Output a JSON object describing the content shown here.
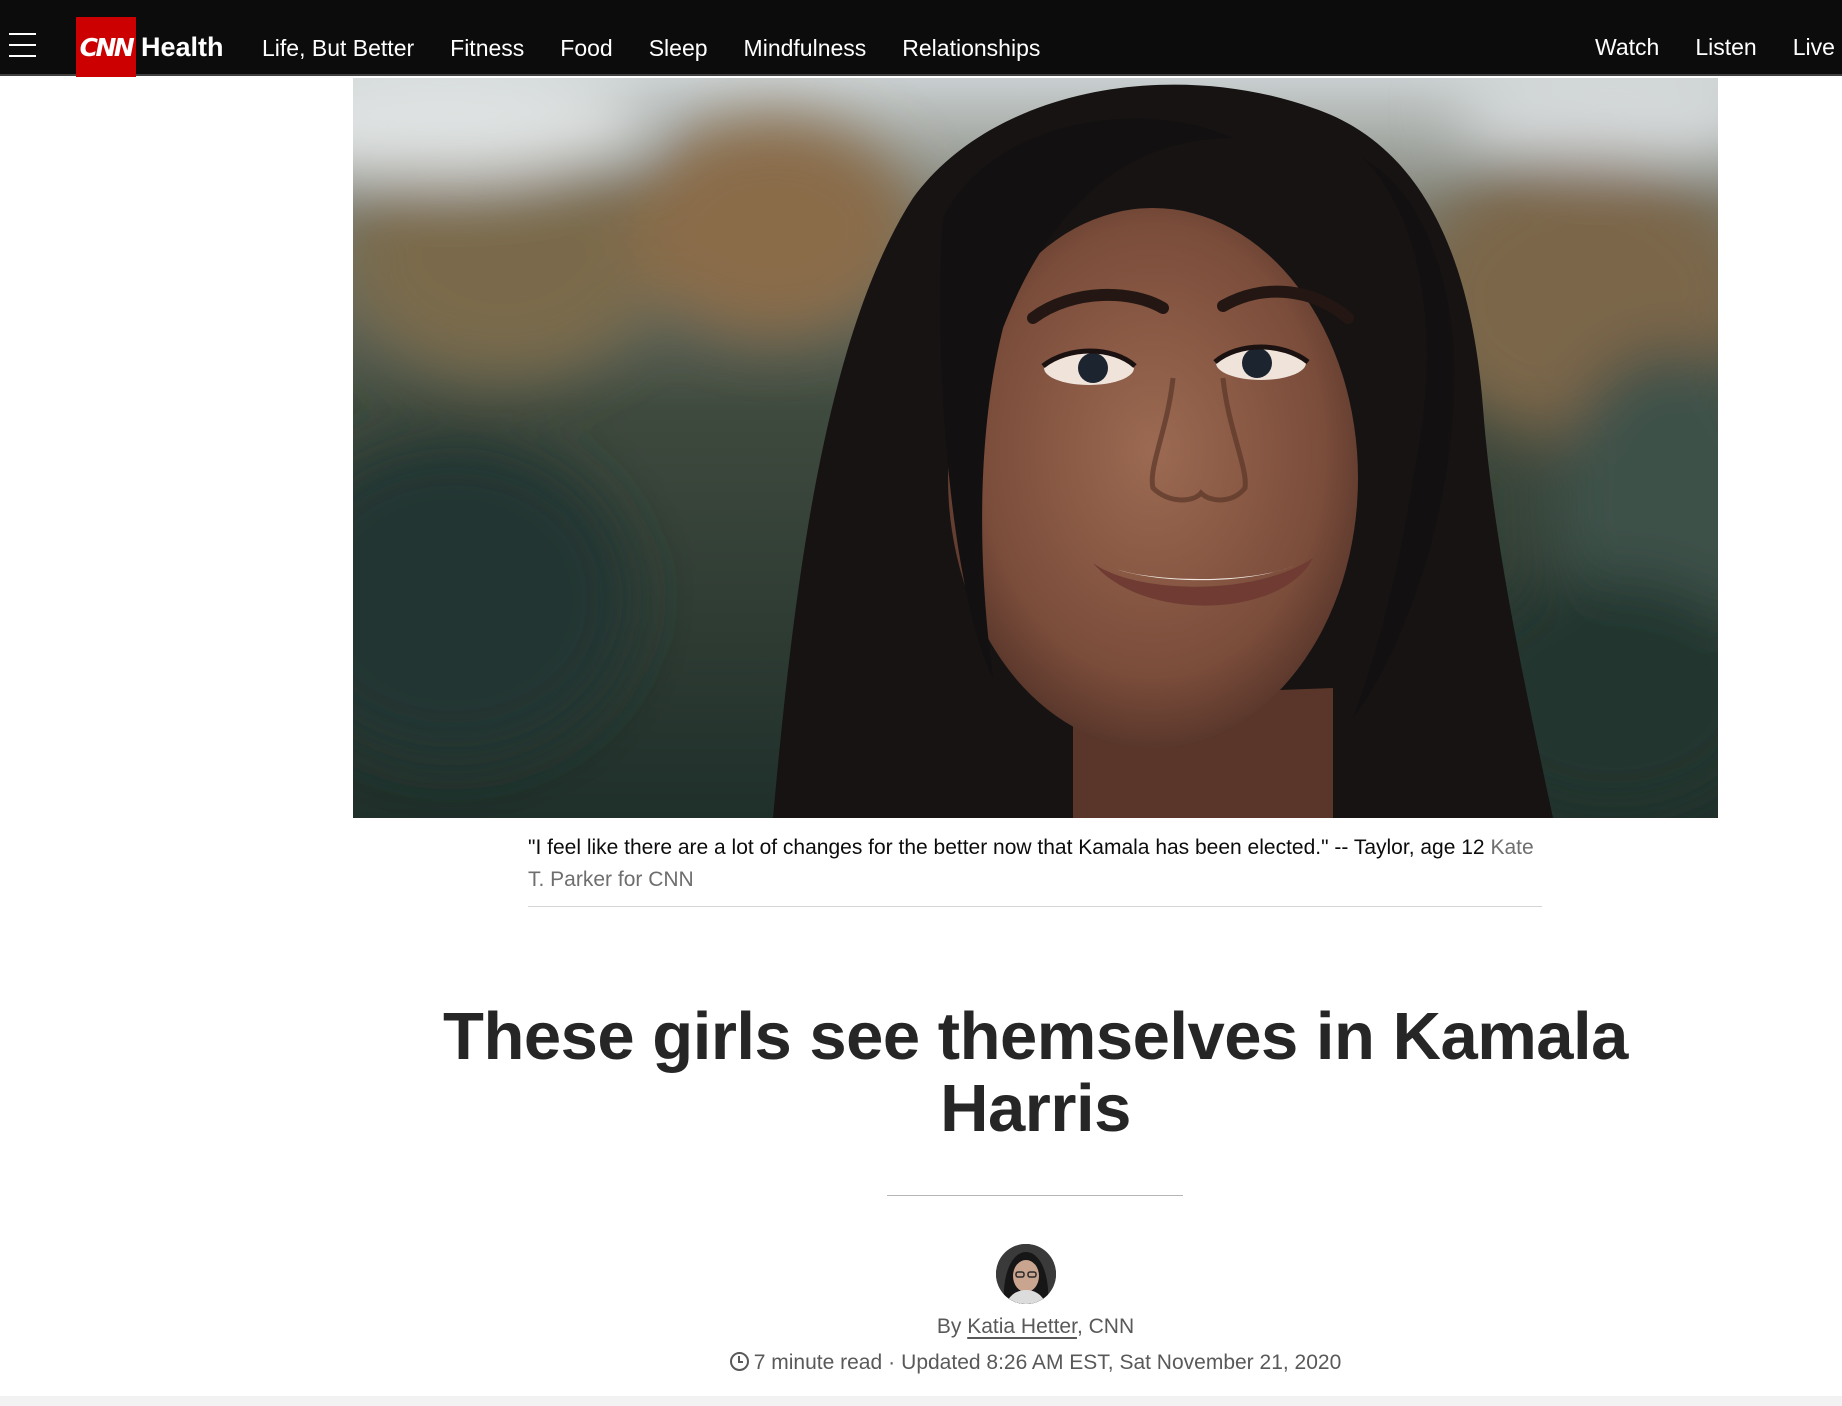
{
  "nav": {
    "logo_text": "CNN",
    "section_title": "Health",
    "links": [
      "Life, But Better",
      "Fitness",
      "Food",
      "Sleep",
      "Mindfulness",
      "Relationships"
    ],
    "right_links": [
      "Watch",
      "Listen",
      "Live"
    ],
    "background": "#0c0c0c",
    "brand_color": "#cc0000"
  },
  "hero": {
    "caption_quote": "\"I feel like there are a lot of changes for the better now that Kamala has been elected.\" -- Taylor, age 12",
    "caption_credit": "Kate T. Parker for CNN"
  },
  "article": {
    "headline": "These girls see themselves in Kamala Harris",
    "byline_prefix": "By",
    "author": "Katia Hetter",
    "byline_suffix": ", CNN",
    "read_time": "7 minute read",
    "separator": "·",
    "updated": "Updated 8:26 AM EST, Sat November 21, 2020"
  }
}
